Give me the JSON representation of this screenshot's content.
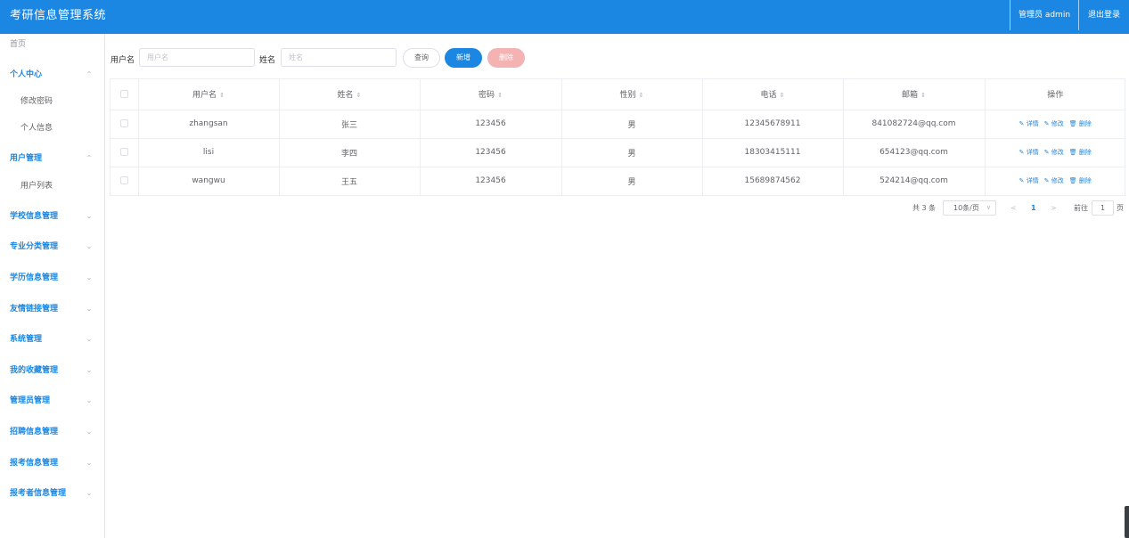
{
  "header": {
    "title": "考研信息管理系统",
    "admin_label": "管理员 admin",
    "logout_label": "退出登录"
  },
  "sidebar": {
    "home": "首页",
    "items": [
      {
        "label": "个人中心",
        "chev": "^"
      },
      {
        "label": "修改密码"
      },
      {
        "label": "个人信息"
      },
      {
        "label": "用户管理",
        "chev": "^"
      },
      {
        "label": "用户列表"
      },
      {
        "label": "学校信息管理",
        "chev": "v"
      },
      {
        "label": "专业分类管理",
        "chev": "v"
      },
      {
        "label": "学历信息管理",
        "chev": "v"
      },
      {
        "label": "友情链接管理",
        "chev": "v"
      },
      {
        "label": "系统管理",
        "chev": "v"
      },
      {
        "label": "我的收藏管理",
        "chev": "v"
      },
      {
        "label": "管理员管理",
        "chev": "v"
      },
      {
        "label": "招聘信息管理",
        "chev": "v"
      },
      {
        "label": "报考信息管理",
        "chev": "v"
      },
      {
        "label": "报考者信息管理",
        "chev": "v"
      }
    ]
  },
  "search": {
    "username_label": "用户名",
    "username_placeholder": "用户名",
    "name_label": "姓名",
    "name_placeholder": "姓名",
    "query_label": "查询",
    "add_label": "新增",
    "delete_label": "删除"
  },
  "table": {
    "columns": [
      "用户名",
      "姓名",
      "密码",
      "性别",
      "电话",
      "邮箱",
      "操作"
    ],
    "sort_glyph": "⇕",
    "rows": [
      {
        "username": "zhangsan",
        "name": "张三",
        "password": "123456",
        "gender": "男",
        "phone": "12345678911",
        "email": "841082724@qq.com"
      },
      {
        "username": "lisi",
        "name": "李四",
        "password": "123456",
        "gender": "男",
        "phone": "18303415111",
        "email": "654123@qq.com"
      },
      {
        "username": "wangwu",
        "name": "王五",
        "password": "123456",
        "gender": "男",
        "phone": "15689874562",
        "email": "524214@qq.com"
      }
    ],
    "actions": {
      "detail": "详情",
      "edit": "修改",
      "delete": "删除"
    }
  },
  "pagination": {
    "total": "共 3 条",
    "page_size": "10条/页",
    "prev": "<",
    "current": "1",
    "next": ">",
    "goto_label": "前往",
    "goto_value": "1",
    "page_suffix": "页"
  },
  "colors": {
    "primary": "#1b87e3",
    "danger_light": "#f5b2b2"
  }
}
